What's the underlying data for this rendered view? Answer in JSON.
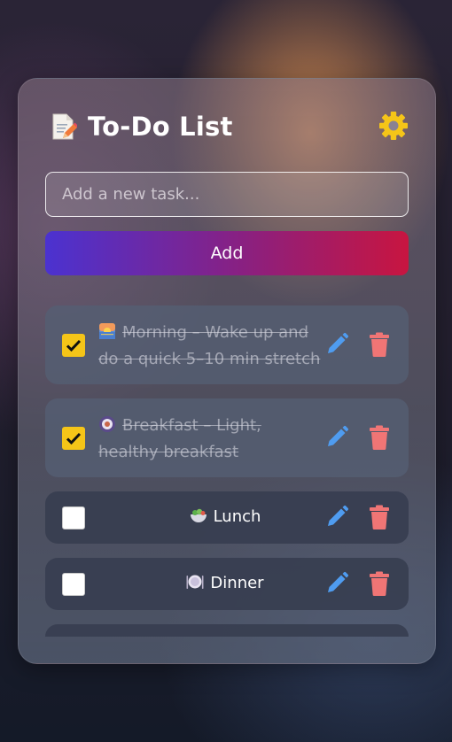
{
  "header": {
    "title": "To-Do List",
    "doc_icon": "document-pencil-icon",
    "settings_icon": "gear-icon"
  },
  "input": {
    "placeholder": "Add a new task..."
  },
  "add_button": {
    "label": "Add"
  },
  "tasks": [
    {
      "emoji": "sunrise-emoji",
      "text": "Morning – Wake up and do a quick 5–10 min stretch",
      "done": true
    },
    {
      "emoji": "coffee-emoji",
      "text": "Breakfast – Light, healthy breakfast",
      "done": true
    },
    {
      "emoji": "salad-emoji",
      "text": "Lunch",
      "done": false
    },
    {
      "emoji": "plate-emoji",
      "text": "Dinner",
      "done": false
    }
  ],
  "colors": {
    "checkbox_checked": "#f5c518",
    "edit_icon": "#4f9cf0",
    "delete_icon": "#f07575",
    "add_gradient": [
      "#4b32d0",
      "#c81540"
    ]
  }
}
